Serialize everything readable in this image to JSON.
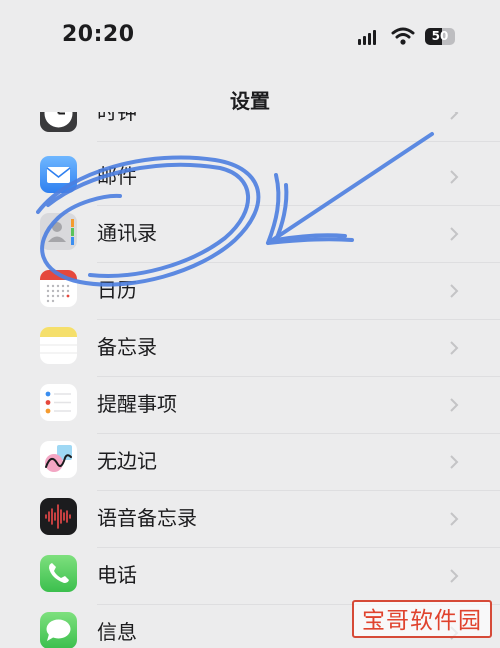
{
  "status_bar": {
    "time": "20:20",
    "battery_percent": "50"
  },
  "nav": {
    "title": "设置"
  },
  "settings_items": [
    {
      "label": "时钟",
      "icon": "clock-icon"
    },
    {
      "label": "邮件",
      "icon": "mail-icon"
    },
    {
      "label": "通讯录",
      "icon": "contacts-icon"
    },
    {
      "label": "日历",
      "icon": "calendar-icon"
    },
    {
      "label": "备忘录",
      "icon": "notes-icon"
    },
    {
      "label": "提醒事项",
      "icon": "reminders-icon"
    },
    {
      "label": "无边记",
      "icon": "freeform-icon"
    },
    {
      "label": "语音备忘录",
      "icon": "voice-memos-icon"
    },
    {
      "label": "电话",
      "icon": "phone-icon"
    },
    {
      "label": "信息",
      "icon": "messages-icon"
    }
  ],
  "watermark": {
    "text": "宝哥软件园"
  },
  "colors": {
    "background": "#ececed",
    "scribble": "#4d7fe0",
    "watermark": "#e0432e"
  }
}
